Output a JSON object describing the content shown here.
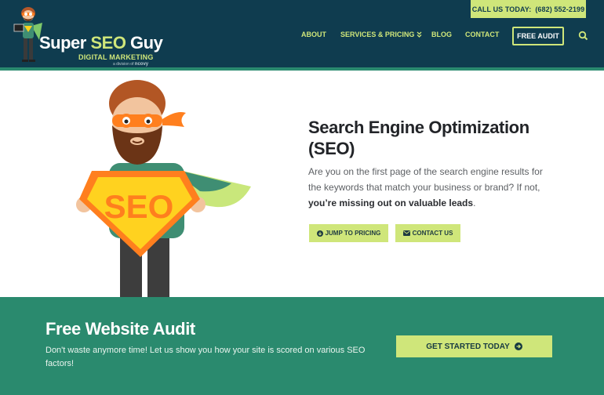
{
  "header": {
    "call_label": "CALL US TODAY:",
    "phone": "(682) 552-2199",
    "logo": {
      "title_a": "Super ",
      "title_seo": "SEO",
      "title_b": " Guy",
      "subtitle": "DIGITAL MARKETING",
      "tagline": "a division of",
      "tagline_brand": "ncovy"
    },
    "nav": {
      "about": "ABOUT",
      "services": "SERVICES & PRICING",
      "blog": "BLOG",
      "contact": "CONTACT",
      "audit": "FREE AUDIT"
    }
  },
  "hero": {
    "title": "Search Engine Optimization (SEO)",
    "body_text": "Are you on the first page of the search engine results for the keywords that match your business or brand? If not,",
    "body_strong": "you’re missing out on valuable leads",
    "body_end": ".",
    "shield_text": "SEO",
    "buttons": {
      "pricing": "JUMP TO PRICING",
      "contact": "CONTACT US"
    }
  },
  "cta": {
    "title": "Free Website Audit",
    "body": "Don't waste anymore time! Let us show you how your site is scored on various SEO factors!",
    "button": "GET STARTED TODAY"
  },
  "icons": {
    "services_caret": "double-chevron-down-icon",
    "search": "search-icon",
    "pricing": "arrow-circle-down-icon",
    "contact": "envelope-icon",
    "cta": "arrow-circle-right-icon"
  },
  "colors": {
    "header_bg": "#0f3c4f",
    "accent_green": "#cfe67a",
    "cta_bg": "#2a8a6e",
    "shield_orange": "#ff7f1e",
    "shield_yellow": "#ffd21f"
  }
}
